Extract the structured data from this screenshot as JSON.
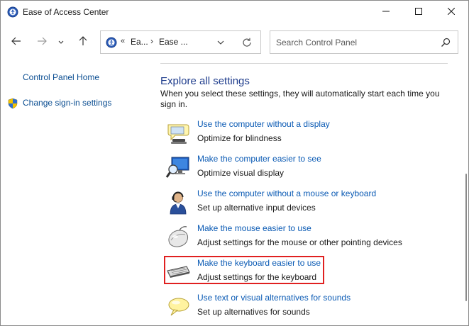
{
  "window": {
    "title": "Ease of Access Center",
    "icon": "ease-of-access-icon",
    "controls": [
      "minimize-icon",
      "maximize-icon",
      "close-icon"
    ]
  },
  "nav": {
    "back_icon": "arrow-left-icon",
    "forward_icon": "arrow-right-icon",
    "recent_icon": "chevron-down-icon",
    "up_icon": "arrow-up-icon"
  },
  "address": {
    "overflow": "«",
    "crumb1": "Ea...",
    "separator": "›",
    "crumb2": "Ease ...",
    "dropdown_icon": "chevron-down-icon",
    "refresh_icon": "refresh-icon"
  },
  "search": {
    "placeholder": "Search Control Panel",
    "value": "",
    "icon": "search-icon"
  },
  "left": {
    "home": "Control Panel Home",
    "signin": "Change sign-in settings",
    "signin_icon": "shield-icon"
  },
  "main": {
    "heading": "Explore all settings",
    "description": "When you select these settings, they will automatically start each time you sign in.",
    "items": [
      {
        "link": "Use the computer without a display",
        "sub": "Optimize for blindness",
        "icon": "speech-display-icon"
      },
      {
        "link": "Make the computer easier to see",
        "sub": "Optimize visual display",
        "icon": "magnifier-monitor-icon"
      },
      {
        "link": "Use the computer without a mouse or keyboard",
        "sub": "Set up alternative input devices",
        "icon": "person-headset-icon"
      },
      {
        "link": "Make the mouse easier to use",
        "sub": "Adjust settings for the mouse or other pointing devices",
        "icon": "mouse-icon"
      },
      {
        "link": "Make the keyboard easier to use",
        "sub": "Adjust settings for the keyboard",
        "icon": "keyboard-icon"
      },
      {
        "link": "Use text or visual alternatives for sounds",
        "sub": "Set up alternatives for sounds",
        "icon": "speech-bubble-icon"
      }
    ]
  },
  "colors": {
    "link": "#0a5ab4",
    "heading": "#1e3c8c",
    "highlight": "#e02020"
  }
}
